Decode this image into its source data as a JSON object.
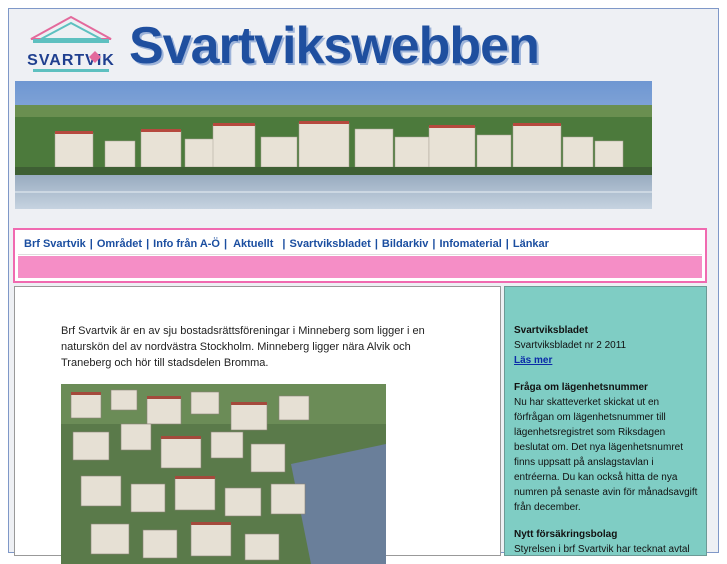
{
  "header": {
    "logo_text": "SVARTVIK",
    "site_title": "Svartvikswebben"
  },
  "nav": {
    "items": [
      {
        "label": "Brf Svartvik"
      },
      {
        "label": "Området"
      },
      {
        "label": "Info från A-Ö"
      },
      {
        "label": "Aktuellt"
      },
      {
        "label": "Svartviksbladet"
      },
      {
        "label": "Bildarkiv"
      },
      {
        "label": "Infomaterial"
      },
      {
        "label": "Länkar"
      }
    ]
  },
  "main": {
    "intro": "Brf Svartvik är en av sju bostadsrättsföreningar i Minneberg som ligger i en naturskön del av nordvästra Stockholm. Minneberg ligger nära Alvik och Traneberg och hör till stadsdelen Bromma."
  },
  "sidebar": {
    "news1": {
      "title": "Svartviksbladet",
      "text": "Svartviksbladet nr 2 2011",
      "link": "Läs mer"
    },
    "news2": {
      "title": "Fråga om lägenhetsnummer",
      "text": "Nu har skatteverket skickat ut en förfrågan om lägenhetsnummer till lägenhetsregistret som Riksdagen beslutat om. Det nya lägenhetsnumret finns uppsatt på anslagstavlan i entréerna. Du kan också hitta de nya numren på senaste avin för månadsavgift från december."
    },
    "news3": {
      "title": "Nytt försäkringsbolag",
      "text": "Styrelsen i brf Svartvik har tecknat avtal"
    }
  },
  "colors": {
    "title_blue": "#1f4f9f",
    "nav_pink": "#f58ec6",
    "sidebar_teal": "#7fcdc4",
    "link_blue": "#0a2aa8"
  }
}
